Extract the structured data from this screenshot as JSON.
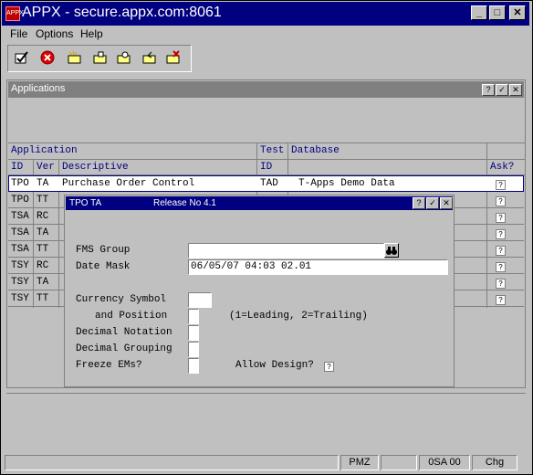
{
  "window": {
    "title": "APPX - secure.appx.com:8061",
    "app_icon": "APPX"
  },
  "window_controls": {
    "minimize": "_",
    "maximize": "□",
    "close": "✕"
  },
  "menu": [
    "File",
    "Options",
    "Help"
  ],
  "toolbar": [
    "check-icon",
    "cancel-icon",
    "new-icon",
    "folder-icon",
    "search-icon",
    "undo-icon",
    "delete-icon"
  ],
  "panel": {
    "title": "Applications",
    "controls": [
      "?",
      "✓",
      "✕"
    ],
    "headers": {
      "application": "Application",
      "id": "ID",
      "ver": "Ver",
      "descriptive": "Descriptive",
      "test": "Test",
      "test_id": "ID",
      "database": "Database",
      "ask": "Ask?"
    },
    "rows": [
      {
        "id": "TPO",
        "ver": "TA",
        "desc": "Purchase Order Control",
        "test": "TAD",
        "db": "T-Apps Demo Data",
        "ask": "?"
      },
      {
        "id": "TPO",
        "ver": "TT",
        "desc": "",
        "test": "",
        "db": "",
        "ask": "?"
      },
      {
        "id": "TSA",
        "ver": "RC",
        "desc": "",
        "test": "",
        "db": "",
        "ask": "?"
      },
      {
        "id": "TSA",
        "ver": "TA",
        "desc": "",
        "test": "",
        "db": "",
        "ask": "?"
      },
      {
        "id": "TSA",
        "ver": "TT",
        "desc": "",
        "test": "",
        "db": "",
        "ask": "?"
      },
      {
        "id": "TSY",
        "ver": "RC",
        "desc": "",
        "test": "",
        "db": "",
        "ask": "?"
      },
      {
        "id": "TSY",
        "ver": "TA",
        "desc": "",
        "test": "",
        "db": "",
        "ask": "?"
      },
      {
        "id": "TSY",
        "ver": "TT",
        "desc": "",
        "test": "",
        "db": "",
        "ask": "?"
      }
    ]
  },
  "dialog": {
    "title_left": "TPO TA",
    "title_right": "Release No 4.1",
    "controls": [
      "?",
      "✓",
      "✕"
    ],
    "fms_group_label": "FMS Group",
    "fms_group_value": "",
    "date_mask_label": "Date Mask",
    "date_mask_value": "06/05/07 04:03 02.01",
    "currency_symbol_label": "Currency Symbol",
    "and_position_label": "and Position",
    "position_hint": "(1=Leading, 2=Trailing)",
    "decimal_notation_label": "Decimal Notation",
    "decimal_grouping_label": "Decimal Grouping",
    "freeze_ems_label": "Freeze EMs?",
    "allow_design_label": "Allow Design?",
    "allow_design_value": "?",
    "binoculars_icon": "binoculars-icon"
  },
  "status": {
    "cells": [
      "PMZ",
      "0SA 00",
      "Chg"
    ]
  }
}
